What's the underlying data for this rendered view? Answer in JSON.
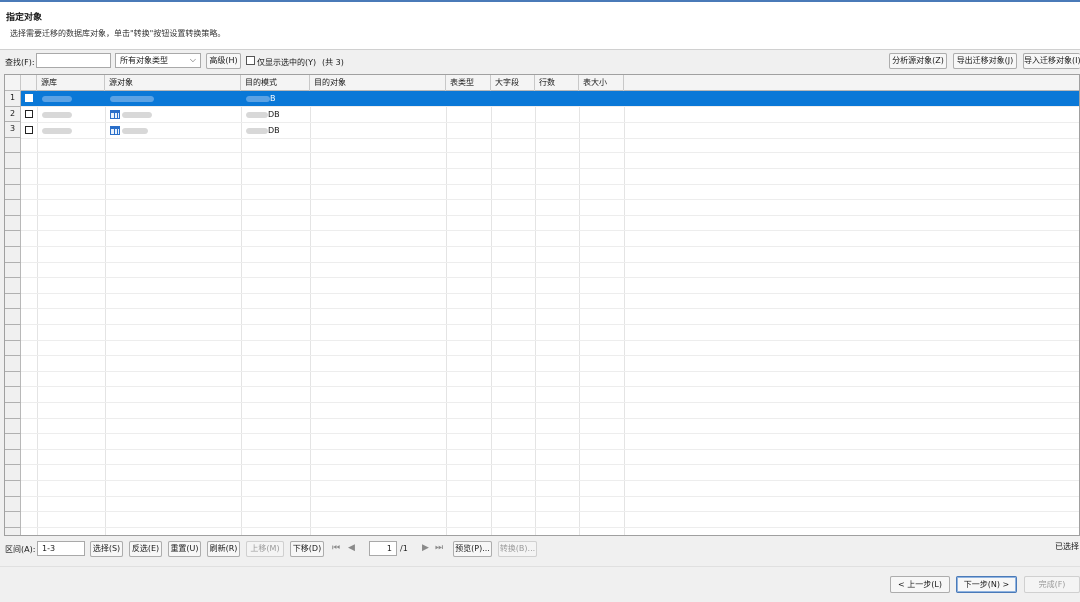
{
  "header": {
    "title": "指定对象",
    "description": "选择需要迁移的数据库对象，单击\"转换\"按钮设置转换策略。"
  },
  "toolbar": {
    "find_label": "查找(F):",
    "find_value": "",
    "object_type_selected": "所有对象类型",
    "advanced_button": "高级(H)",
    "only_selected_label": "仅显示选中的(Y)",
    "count_text": "(共 3)",
    "analyze_button": "分析源对象(Z)",
    "export_button": "导出迁移对象(J)",
    "import_button": "导入迁移对象(I)"
  },
  "grid": {
    "columns": [
      "源库",
      "源对象",
      "目的模式",
      "目的对象",
      "表类型",
      "大字段",
      "行数",
      "表大小"
    ],
    "rows": [
      {
        "num": "1",
        "target_schema_suffix": "B",
        "selected": true
      },
      {
        "num": "2",
        "target_schema_suffix": "DB",
        "selected": false
      },
      {
        "num": "3",
        "target_schema_suffix": "DB",
        "selected": false
      }
    ]
  },
  "bottom": {
    "range_label": "区间(A):",
    "range_value": "1-3",
    "select_button": "选择(S)",
    "invert_button": "反选(E)",
    "reset_button": "重置(U)",
    "refresh_button": "刷新(R)",
    "move_up_button": "上移(M)",
    "move_down_button": "下移(D)",
    "page_value": "1",
    "page_total": "/1",
    "preview_button": "预览(P)...",
    "convert_button": "转换(B)...",
    "selected_status": "已选择"
  },
  "footer": {
    "prev_button": "< 上一步(L)",
    "next_button": "下一步(N) >",
    "finish_button": "完成(F)"
  },
  "colors": {
    "selection": "#0a78d7",
    "accent": "#4a7ab8"
  }
}
